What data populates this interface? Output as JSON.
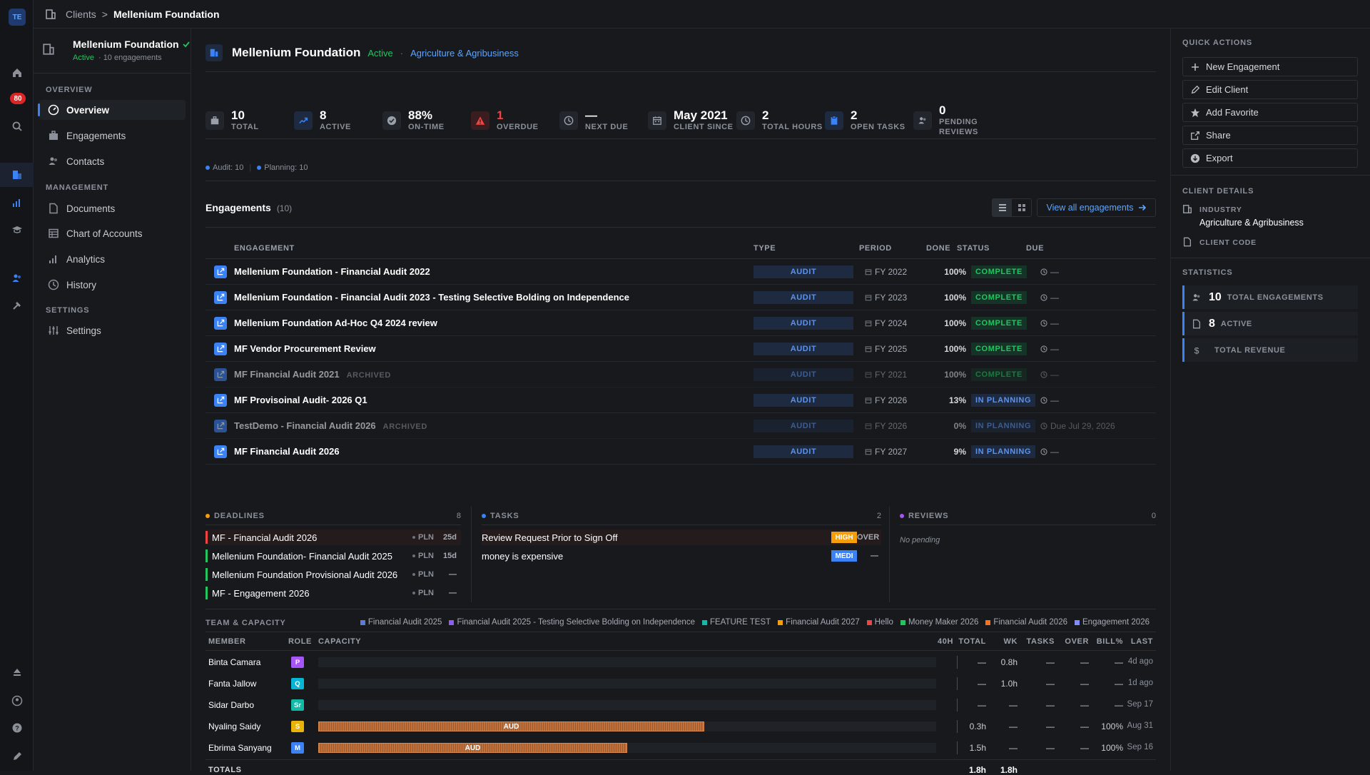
{
  "rail": {
    "avatar": "TE",
    "notif_count": "80"
  },
  "breadcrumb": {
    "root": "Clients",
    "sep": ">",
    "current": "Mellenium Foundation"
  },
  "sidebar": {
    "client_name": "Mellenium Foundation",
    "client_status": "Active",
    "client_meta": "· 10 engagements",
    "sections": [
      {
        "label": "OVERVIEW",
        "items": [
          {
            "label": "Overview",
            "icon": "dashboard-icon"
          },
          {
            "label": "Engagements",
            "icon": "briefcase-icon"
          },
          {
            "label": "Contacts",
            "icon": "contacts-icon"
          }
        ]
      },
      {
        "label": "MANAGEMENT",
        "items": [
          {
            "label": "Documents",
            "icon": "document-icon"
          },
          {
            "label": "Chart of Accounts",
            "icon": "table-icon"
          },
          {
            "label": "Analytics",
            "icon": "bar-chart-icon"
          },
          {
            "label": "History",
            "icon": "clock-icon"
          }
        ]
      },
      {
        "label": "SETTINGS",
        "items": [
          {
            "label": "Settings",
            "icon": "sliders-icon"
          }
        ]
      }
    ]
  },
  "header": {
    "title": "Mellenium Foundation",
    "status": "Active",
    "dot": "·",
    "industry": "Agriculture & Agribusiness"
  },
  "stats": [
    {
      "value": "10",
      "label": "TOTAL",
      "icon": "briefcase-icon"
    },
    {
      "value": "8",
      "label": "ACTIVE",
      "icon": "trend-up-icon"
    },
    {
      "value": "88%",
      "label": "ON-TIME",
      "icon": "check-circle-icon"
    },
    {
      "value": "1",
      "label": "OVERDUE",
      "icon": "warning-icon"
    },
    {
      "value": "—",
      "label": "NEXT DUE",
      "icon": "clock-icon"
    },
    {
      "value": "May 2021",
      "label": "CLIENT SINCE",
      "icon": "calendar-icon"
    },
    {
      "value": "2",
      "label": "TOTAL HOURS",
      "icon": "clock-icon"
    },
    {
      "value": "2",
      "label": "OPEN TASKS",
      "icon": "clipboard-icon"
    },
    {
      "value": "0",
      "label": "PENDING",
      "label2": "REVIEWS",
      "icon": "reviewer-icon"
    }
  ],
  "type_tags": [
    {
      "label": "Audit: 10"
    },
    {
      "label": "Planning: 10"
    }
  ],
  "engagements": {
    "title": "Engagements",
    "count": "(10)",
    "view_all": "View all engagements",
    "columns": {
      "engagement": "ENGAGEMENT",
      "type": "TYPE",
      "period": "PERIOD",
      "done": "DONE",
      "status": "STATUS",
      "due": "DUE"
    },
    "rows": [
      {
        "name": "Mellenium Foundation - Financial Audit 2022",
        "archived": "",
        "type": "AUDIT",
        "period": "FY 2022",
        "done": "100%",
        "status": "COMPLETE",
        "due": "—"
      },
      {
        "name": "Mellenium Foundation - Financial Audit 2023 - Testing Selective Bolding on Independence",
        "archived": "",
        "type": "AUDIT",
        "period": "FY 2023",
        "done": "100%",
        "status": "COMPLETE",
        "due": "—"
      },
      {
        "name": "Mellenium Foundation Ad-Hoc Q4 2024 review",
        "archived": "",
        "type": "AUDIT",
        "period": "FY 2024",
        "done": "100%",
        "status": "COMPLETE",
        "due": "—"
      },
      {
        "name": "MF Vendor Procurement Review",
        "archived": "",
        "type": "AUDIT",
        "period": "FY 2025",
        "done": "100%",
        "status": "COMPLETE",
        "due": "—"
      },
      {
        "name": "MF Financial Audit 2021",
        "archived": "ARCHIVED",
        "type": "AUDIT",
        "period": "FY 2021",
        "done": "100%",
        "status": "COMPLETE",
        "due": "—"
      },
      {
        "name": "MF Provisoinal Audit- 2026 Q1",
        "archived": "",
        "type": "AUDIT",
        "period": "FY 2026",
        "done": "13%",
        "status": "IN PLANNING",
        "due": "—"
      },
      {
        "name": "TestDemo - Financial Audit 2026",
        "archived": "ARCHIVED",
        "type": "AUDIT",
        "period": "FY 2026",
        "done": "0%",
        "status": "IN PLANNING",
        "due": "Due Jul 29, 2026"
      },
      {
        "name": "MF Financial Audit 2026",
        "archived": "",
        "type": "AUDIT",
        "period": "FY 2027",
        "done": "9%",
        "status": "IN PLANNING",
        "due": "—"
      }
    ]
  },
  "deadlines": {
    "title": "DEADLINES",
    "count": "8",
    "items": [
      {
        "name": "MF - Financial Audit 2026",
        "phase": "PLN",
        "days": "25d",
        "color": "#ef4444"
      },
      {
        "name": "Mellenium Foundation- Financial Audit 2025",
        "phase": "PLN",
        "days": "15d",
        "color": "#22c55e"
      },
      {
        "name": "Mellenium Foundation Provisional Audit 2026",
        "phase": "PLN",
        "days": "—",
        "color": "#22c55e"
      },
      {
        "name": "MF - Engagement 2026",
        "phase": "PLN",
        "days": "—",
        "color": "#22c55e"
      }
    ]
  },
  "tasks": {
    "title": "TASKS",
    "count": "2",
    "items": [
      {
        "name": "Review Request Prior to Sign Off",
        "priority": "HIGH",
        "due": "OVER",
        "color": "#f59e0b"
      },
      {
        "name": "money is expensive",
        "priority": "MEDI",
        "due": "—",
        "color": "#3b82f6"
      }
    ]
  },
  "reviews": {
    "title": "REVIEWS",
    "count": "0",
    "empty": "No pending"
  },
  "team": {
    "title": "TEAM & CAPACITY",
    "legend": [
      {
        "label": "Financial Audit 2025",
        "color": "#5b7bd6"
      },
      {
        "label": "Financial Audit 2025 - Testing Selective Bolding on Independence",
        "color": "#8b5cf6"
      },
      {
        "label": "FEATURE TEST",
        "color": "#14b8a6"
      },
      {
        "label": "Financial Audit 2027",
        "color": "#f59e0b"
      },
      {
        "label": "Hello",
        "color": "#ef4444"
      },
      {
        "label": "Money Maker 2026",
        "color": "#22c55e"
      },
      {
        "label": "Financial Audit 2026",
        "color": "#f97316"
      },
      {
        "label": "Engagement 2026",
        "color": "#818cf8"
      }
    ],
    "columns": {
      "member": "MEMBER",
      "role": "ROLE",
      "capacity": "CAPACITY",
      "max": "40H",
      "total": "TOTAL",
      "wk": "WK",
      "tasks": "TASKS",
      "over": "OVER",
      "bill": "BILL%",
      "last": "LAST"
    },
    "members": [
      {
        "name": "Binta Camara",
        "role": "P",
        "role_color": "#a855f7",
        "fill": 0,
        "bar_label": "",
        "total": "—",
        "wk": "0.8h",
        "tasks": "—",
        "over": "—",
        "bill": "—",
        "last": "4d ago"
      },
      {
        "name": "Fanta Jallow",
        "role": "Q",
        "role_color": "#06b6d4",
        "fill": 0,
        "bar_label": "",
        "total": "—",
        "wk": "1.0h",
        "tasks": "—",
        "over": "—",
        "bill": "—",
        "last": "1d ago"
      },
      {
        "name": "Sidar Darbo",
        "role": "Sr",
        "role_color": "#14b8a6",
        "fill": 0,
        "bar_label": "",
        "total": "—",
        "wk": "—",
        "tasks": "—",
        "over": "—",
        "bill": "—",
        "last": "Sep 17"
      },
      {
        "name": "Nyaling Saidy",
        "role": "S",
        "role_color": "#eab308",
        "fill": 0.625,
        "bar_label": "AUD",
        "total": "0.3h",
        "wk": "—",
        "tasks": "—",
        "over": "—",
        "bill": "100%",
        "last": "Aug 31"
      },
      {
        "name": "Ebrima Sanyang",
        "role": "M",
        "role_color": "#3b82f6",
        "fill": 0.5,
        "bar_label": "AUD",
        "total": "1.5h",
        "wk": "—",
        "tasks": "—",
        "over": "—",
        "bill": "100%",
        "last": "Sep 16"
      }
    ],
    "totals": {
      "label": "TOTALS",
      "total": "1.8h",
      "wk": "1.8h"
    }
  },
  "right": {
    "quick_title": "QUICK ACTIONS",
    "actions": [
      {
        "label": "New Engagement",
        "icon": "plus-icon"
      },
      {
        "label": "Edit Client",
        "icon": "pencil-icon"
      },
      {
        "label": "Add Favorite",
        "icon": "star-icon"
      },
      {
        "label": "Share",
        "icon": "share-icon"
      },
      {
        "label": "Export",
        "icon": "download-icon"
      }
    ],
    "details_title": "CLIENT DETAILS",
    "industry_label": "INDUSTRY",
    "industry_value": "Agriculture & Agribusiness",
    "code_label": "CLIENT CODE",
    "stats_title": "STATISTICS",
    "stats": [
      {
        "value": "10",
        "label": "TOTAL ENGAGEMENTS"
      },
      {
        "value": "8",
        "label": "ACTIVE"
      },
      {
        "value": "",
        "label": "TOTAL REVENUE"
      }
    ]
  }
}
